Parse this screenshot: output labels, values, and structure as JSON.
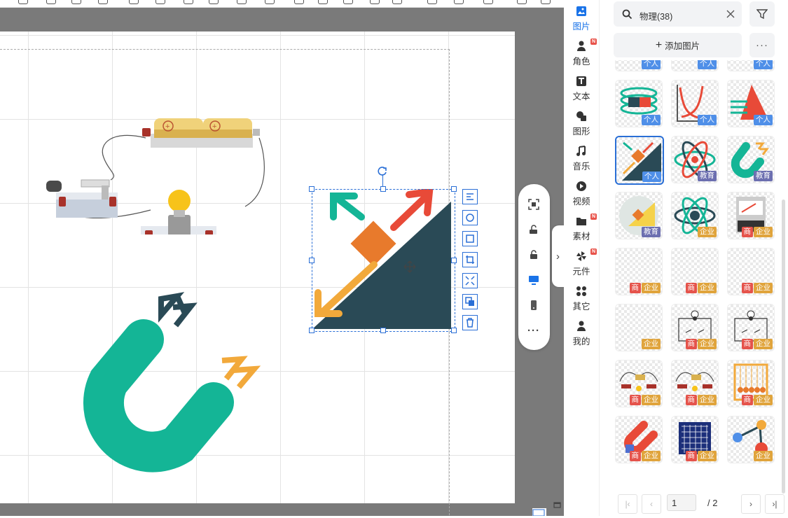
{
  "nav": [
    {
      "id": "images",
      "label": "图片",
      "icon": "image-icon",
      "active": true,
      "badge": ""
    },
    {
      "id": "characters",
      "label": "角色",
      "icon": "person-icon",
      "active": false,
      "badge": "N"
    },
    {
      "id": "text",
      "label": "文本",
      "icon": "text-icon",
      "active": false,
      "badge": ""
    },
    {
      "id": "shapes",
      "label": "图形",
      "icon": "shapes-icon",
      "active": false,
      "badge": ""
    },
    {
      "id": "music",
      "label": "音乐",
      "icon": "music-icon",
      "active": false,
      "badge": ""
    },
    {
      "id": "video",
      "label": "视频",
      "icon": "video-icon",
      "active": false,
      "badge": ""
    },
    {
      "id": "material",
      "label": "素材",
      "icon": "folder-icon",
      "active": false,
      "badge": "N"
    },
    {
      "id": "components",
      "label": "元件",
      "icon": "pinwheel-icon",
      "active": false,
      "badge": "N"
    },
    {
      "id": "other",
      "label": "其它",
      "icon": "grid-icon",
      "active": false,
      "badge": ""
    },
    {
      "id": "mine",
      "label": "我的",
      "icon": "user-icon",
      "active": false,
      "badge": ""
    }
  ],
  "panel": {
    "search_value": "物理(38)",
    "add_label": "添加图片",
    "more_label": "···"
  },
  "tags": {
    "personal": "个人",
    "edu": "教育",
    "ent": "企业",
    "com": "商"
  },
  "thumbs": [
    {
      "kind": "coil",
      "tags": [
        "personal"
      ]
    },
    {
      "kind": "graph",
      "tags": [
        "personal"
      ]
    },
    {
      "kind": "prism",
      "tags": [
        "personal"
      ]
    },
    {
      "kind": "diag",
      "tags": [
        "personal"
      ],
      "selected": true
    },
    {
      "kind": "atom",
      "tags": [
        "edu"
      ]
    },
    {
      "kind": "magnet",
      "tags": [
        "edu"
      ]
    },
    {
      "kind": "pie",
      "tags": [
        "edu"
      ]
    },
    {
      "kind": "atom2",
      "tags": [
        "ent"
      ]
    },
    {
      "kind": "meter",
      "tags": [
        "com",
        "ent"
      ]
    },
    {
      "kind": "blank",
      "tags": [
        "com",
        "ent"
      ]
    },
    {
      "kind": "blank",
      "tags": [
        "com",
        "ent"
      ]
    },
    {
      "kind": "blank",
      "tags": [
        "com",
        "ent"
      ]
    },
    {
      "kind": "blank",
      "tags": [
        "ent"
      ]
    },
    {
      "kind": "circuit",
      "tags": [
        "com",
        "ent"
      ]
    },
    {
      "kind": "circuit",
      "tags": [
        "com",
        "ent"
      ]
    },
    {
      "kind": "wires",
      "tags": [
        "com",
        "ent"
      ]
    },
    {
      "kind": "wires",
      "tags": [
        "com",
        "ent"
      ]
    },
    {
      "kind": "cradle",
      "tags": [
        "com",
        "ent"
      ]
    },
    {
      "kind": "umagnet",
      "tags": [
        "com",
        "ent"
      ]
    },
    {
      "kind": "chip",
      "tags": [
        "com",
        "ent"
      ]
    },
    {
      "kind": "molecule",
      "tags": [
        "ent"
      ]
    }
  ],
  "pager": {
    "current": "1",
    "total": "/ 2"
  },
  "colors": {
    "accent": "#1a73e8",
    "teal": "#14b596",
    "dark": "#2a4a56",
    "orange": "#e87a2c",
    "red": "#e84a38",
    "yellow": "#f2a93b"
  }
}
